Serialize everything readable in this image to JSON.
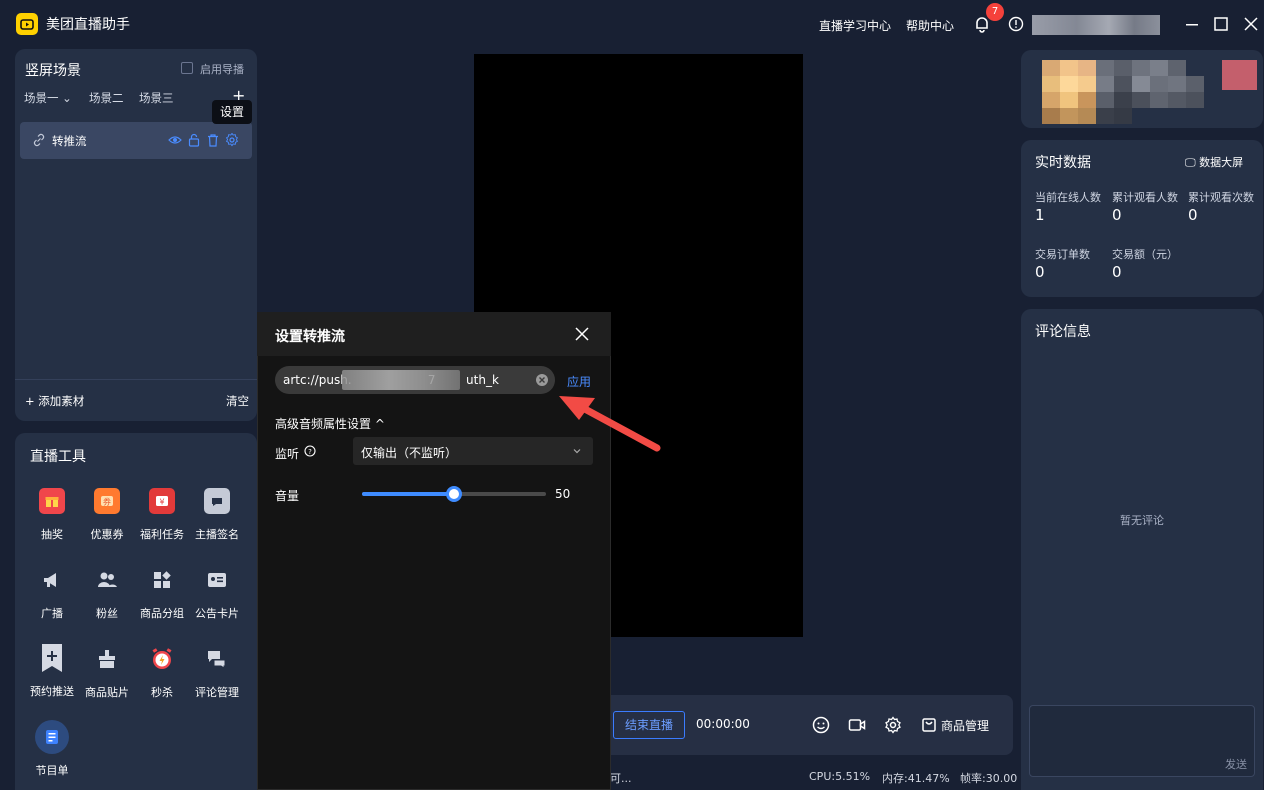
{
  "app": {
    "title": "美团直播助手",
    "links": {
      "learning": "直播学习中心",
      "help": "帮助中心"
    },
    "notification_count": "7"
  },
  "scene": {
    "title": "竖屏场景",
    "guide_label": "启用导播",
    "tabs": [
      "场景一",
      "场景二",
      "场景三"
    ],
    "tooltip": "设置",
    "source_label": "转推流",
    "add_material": "+ 添加素材",
    "clear": "清空"
  },
  "tools": {
    "title": "直播工具",
    "items": [
      {
        "label": "抽奖",
        "icon": "gift-icon"
      },
      {
        "label": "优惠券",
        "icon": "coupon-icon"
      },
      {
        "label": "福利任务",
        "icon": "welfare-task-icon"
      },
      {
        "label": "主播签名",
        "icon": "signature-icon"
      },
      {
        "label": "广播",
        "icon": "broadcast-icon"
      },
      {
        "label": "粉丝",
        "icon": "fans-icon"
      },
      {
        "label": "商品分组",
        "icon": "product-group-icon"
      },
      {
        "label": "公告卡片",
        "icon": "notice-card-icon"
      },
      {
        "label": "预约推送",
        "icon": "reservation-push-icon"
      },
      {
        "label": "商品贴片",
        "icon": "product-sticker-icon"
      },
      {
        "label": "秒杀",
        "icon": "flash-sale-icon"
      },
      {
        "label": "评论管理",
        "icon": "comment-manage-icon"
      },
      {
        "label": "节目单",
        "icon": "program-list-icon"
      }
    ]
  },
  "controls": {
    "end_live": "结束直播",
    "timer": "00:00:00",
    "goods_manage": "商品管理"
  },
  "status": {
    "truncated": "可...",
    "cpu": "CPU:5.51%",
    "memory": "内存:41.47%",
    "fps": "帧率:30.00"
  },
  "realtime": {
    "title": "实时数据",
    "dashboard": "数据大屏",
    "metrics": [
      {
        "label": "当前在线人数",
        "value": "1"
      },
      {
        "label": "累计观看人数",
        "value": "0"
      },
      {
        "label": "累计观看次数",
        "value": "0"
      },
      {
        "label": "交易订单数",
        "value": "0"
      },
      {
        "label": "交易额（元）",
        "value": "0"
      }
    ]
  },
  "comments": {
    "title": "评论信息",
    "empty": "暂无评论",
    "send": "发送"
  },
  "modal": {
    "title": "设置转推流",
    "url_value": "artc://push.                    7        uth_k",
    "apply": "应用",
    "advanced_audio": "高级音频属性设置 ^",
    "monitor_label": "监听",
    "monitor_value": "仅输出（不监听）",
    "volume_label": "音量",
    "volume": 50
  },
  "colors": {
    "accent": "#3f8cff",
    "arrow": "#f24b45",
    "logo": "#ffd100"
  }
}
